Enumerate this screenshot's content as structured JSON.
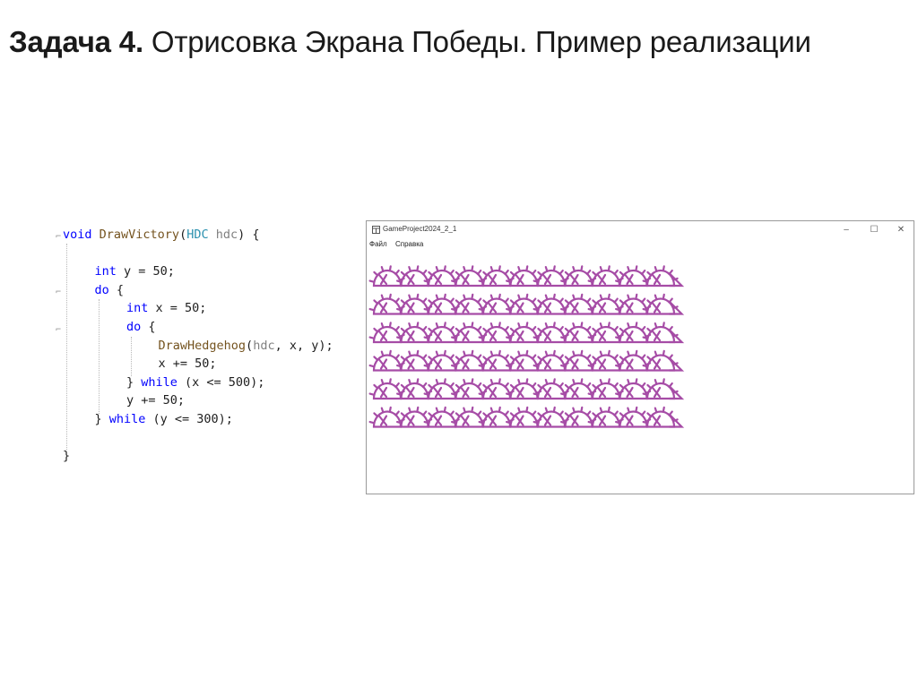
{
  "slide": {
    "title_bold": "Задача 4.",
    "title_rest": " Отрисовка Экрана Победы. Пример реализации"
  },
  "code": {
    "lines": [
      [
        {
          "t": "void",
          "c": "kw"
        },
        {
          "t": " ",
          "c": "pl"
        },
        {
          "t": "DrawVictory",
          "c": "fn"
        },
        {
          "t": "(",
          "c": "pl"
        },
        {
          "t": "HDC",
          "c": "ty"
        },
        {
          "t": " ",
          "c": "pl"
        },
        {
          "t": "hdc",
          "c": "pr"
        },
        {
          "t": ") {",
          "c": "pl"
        }
      ],
      [],
      [
        {
          "t": "int",
          "c": "kw"
        },
        {
          "t": " y = 50;",
          "c": "pl"
        }
      ],
      [
        {
          "t": "do",
          "c": "kw"
        },
        {
          "t": " {",
          "c": "pl"
        }
      ],
      [
        {
          "t": "int",
          "c": "kw"
        },
        {
          "t": " x = 50;",
          "c": "pl"
        }
      ],
      [
        {
          "t": "do",
          "c": "kw"
        },
        {
          "t": " {",
          "c": "pl"
        }
      ],
      [
        {
          "t": "DrawHedgehog",
          "c": "fn"
        },
        {
          "t": "(",
          "c": "pl"
        },
        {
          "t": "hdc",
          "c": "pr"
        },
        {
          "t": ", x, y);",
          "c": "pl"
        }
      ],
      [
        {
          "t": "x += 50;",
          "c": "pl"
        }
      ],
      [
        {
          "t": "} ",
          "c": "pl"
        },
        {
          "t": "while",
          "c": "kw"
        },
        {
          "t": " (x <= 500);",
          "c": "pl"
        }
      ],
      [
        {
          "t": "y += 50;",
          "c": "pl"
        }
      ],
      [
        {
          "t": "} ",
          "c": "pl"
        },
        {
          "t": "while",
          "c": "kw"
        },
        {
          "t": " (y <= 300);",
          "c": "pl"
        }
      ],
      [],
      [
        {
          "t": "}",
          "c": "pl"
        }
      ]
    ],
    "indents": [
      0,
      0,
      1,
      1,
      2,
      2,
      3,
      3,
      2,
      2,
      1,
      0,
      0
    ]
  },
  "window": {
    "title": "GameProject2024_2_1",
    "menu": [
      "Файл",
      "Справка"
    ],
    "controls": {
      "minimize": "–",
      "maximize": "☐",
      "close": "✕"
    },
    "hedgehog_color": "#a64ca6",
    "grid": {
      "columns": 11,
      "rows": 6
    }
  }
}
